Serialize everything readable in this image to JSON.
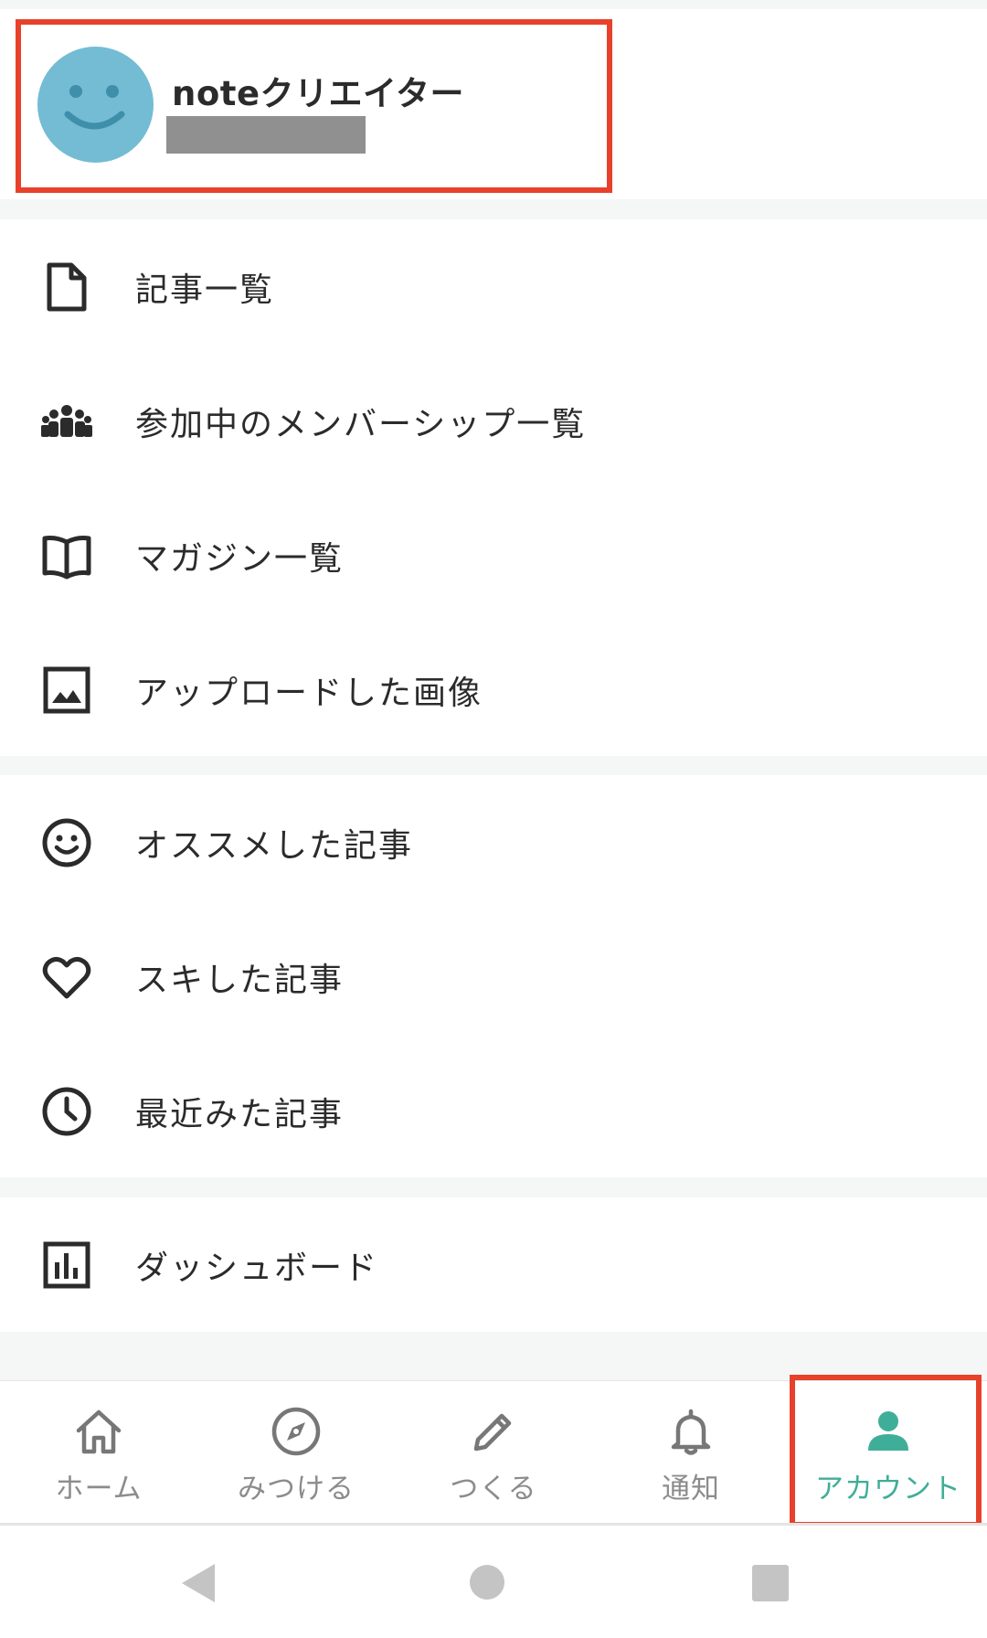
{
  "profile": {
    "name": "noteクリエイター",
    "avatar_icon": "smiley-face-icon",
    "avatar_color": "#73bcd4"
  },
  "menu_groups": [
    [
      {
        "label": "記事一覧",
        "icon": "document-icon"
      },
      {
        "label": "参加中のメンバーシップ一覧",
        "icon": "group-icon"
      },
      {
        "label": "マガジン一覧",
        "icon": "book-icon"
      },
      {
        "label": "アップロードした画像",
        "icon": "image-icon"
      }
    ],
    [
      {
        "label": "オススメした記事",
        "icon": "smiley-icon"
      },
      {
        "label": "スキした記事",
        "icon": "heart-icon"
      },
      {
        "label": "最近みた記事",
        "icon": "clock-icon"
      }
    ],
    [
      {
        "label": "ダッシュボード",
        "icon": "bar-chart-icon"
      }
    ]
  ],
  "bottom_nav": [
    {
      "label": "ホーム",
      "icon": "home-icon"
    },
    {
      "label": "みつける",
      "icon": "compass-icon"
    },
    {
      "label": "つくる",
      "icon": "pencil-icon"
    },
    {
      "label": "通知",
      "icon": "bell-icon"
    },
    {
      "label": "アカウント",
      "icon": "person-icon",
      "active": true
    }
  ],
  "colors": {
    "accent": "#3fae98",
    "highlight": "#e8412b",
    "text": "#2b2b2b",
    "nav_inactive": "#8c8c8c"
  }
}
